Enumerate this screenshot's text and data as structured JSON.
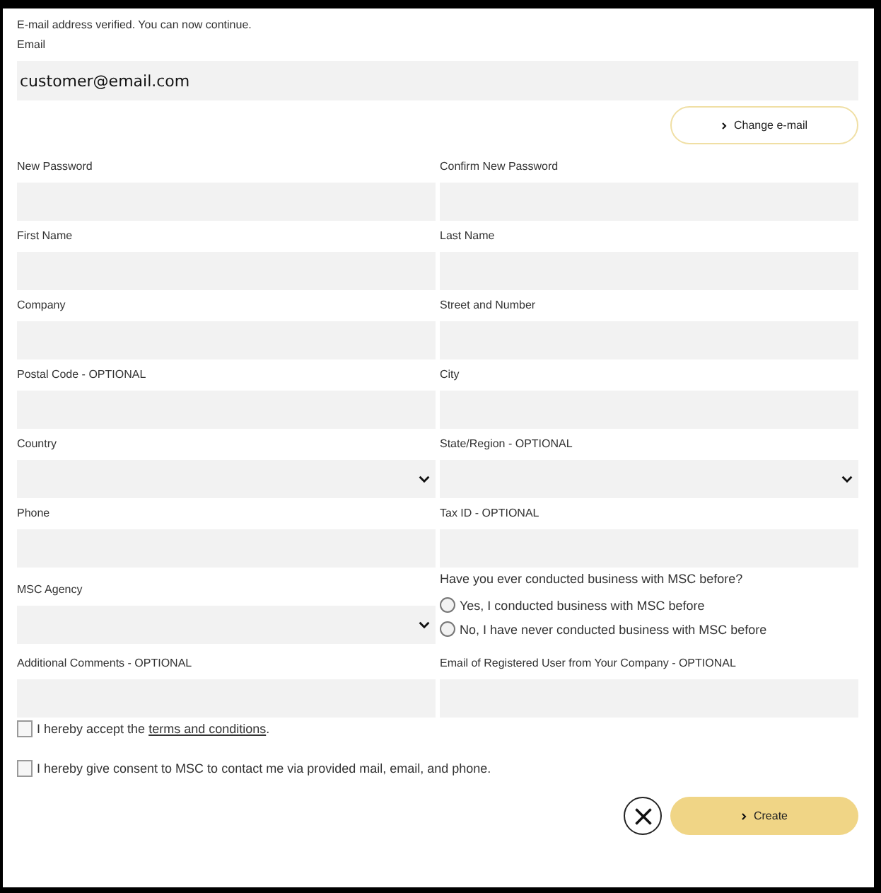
{
  "notice": "E-mail address verified. You can now continue.",
  "email": {
    "label": "Email",
    "value": "customer@email.com"
  },
  "change_button": {
    "label": "Change e-mail"
  },
  "rows": [
    [
      {
        "kind": "text",
        "label": "New Password"
      },
      {
        "kind": "text",
        "label": "Confirm New Password"
      }
    ],
    [
      {
        "kind": "text",
        "label": "First Name"
      },
      {
        "kind": "text",
        "label": "Last Name"
      }
    ],
    [
      {
        "kind": "text",
        "label": "Company"
      },
      {
        "kind": "text",
        "label": "Street and Number"
      }
    ],
    [
      {
        "kind": "text",
        "label": "Postal Code - OPTIONAL"
      },
      {
        "kind": "text",
        "label": "City"
      }
    ],
    [
      {
        "kind": "select",
        "label": "Country"
      },
      {
        "kind": "select",
        "label": "State/Region - OPTIONAL"
      }
    ],
    [
      {
        "kind": "text",
        "label": "Phone"
      },
      {
        "kind": "text",
        "label": "Tax ID - OPTIONAL"
      }
    ],
    [
      {
        "kind": "select",
        "label": "MSC Agency"
      },
      {
        "kind": "radio",
        "label": "Have you ever conducted business with MSC before?",
        "options": [
          {
            "label": "Yes, I conducted business with MSC before",
            "selected": false
          },
          {
            "label": "No, I have never conducted business with MSC before",
            "selected": false
          }
        ]
      }
    ],
    [
      {
        "kind": "text",
        "label": "Additional Comments - OPTIONAL"
      },
      {
        "kind": "text",
        "label": "Email of Registered User from Your Company - OPTIONAL"
      }
    ]
  ],
  "checkboxes": [
    {
      "text": "I hereby accept the ",
      "link": "terms and conditions",
      "text_after": ".",
      "checked": false
    },
    {
      "text": "I hereby give consent to MSC to contact me via provided mail, email, and phone.",
      "checked": false
    }
  ],
  "create_button": {
    "label": "Create"
  }
}
